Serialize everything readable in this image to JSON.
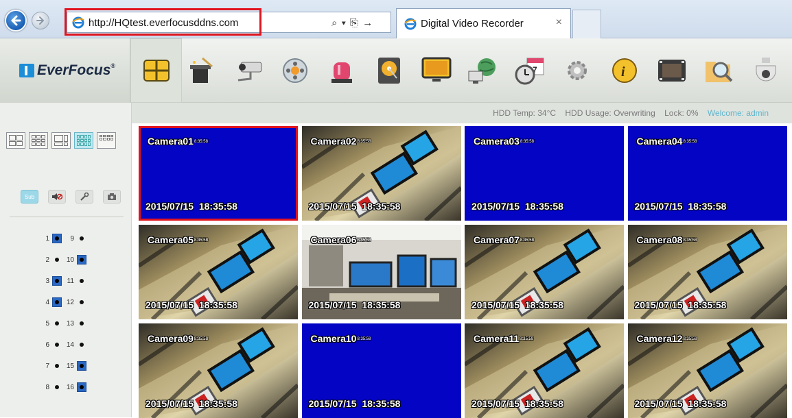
{
  "browser": {
    "url": "http://HQtest.everfocusddns.com",
    "address_tools": "⌕ ▾ ⎘ →",
    "tab_title": "Digital Video Recorder",
    "tab_close": "×"
  },
  "app": {
    "logo_text": "EverFocus",
    "logo_mark": "®"
  },
  "toolbar": {
    "items": [
      {
        "name": "live-view-icon",
        "active": true
      },
      {
        "name": "wizard-icon"
      },
      {
        "name": "camera-icon"
      },
      {
        "name": "record-icon"
      },
      {
        "name": "alarm-icon"
      },
      {
        "name": "hdd-icon"
      },
      {
        "name": "display-icon"
      },
      {
        "name": "network-icon"
      },
      {
        "name": "schedule-icon"
      },
      {
        "name": "settings-icon"
      },
      {
        "name": "info-icon"
      },
      {
        "name": "playback-icon"
      },
      {
        "name": "search-icon"
      },
      {
        "name": "ptz-icon"
      }
    ]
  },
  "status": {
    "hdd_temp_label": "HDD Temp:",
    "hdd_temp_value": "34°C",
    "hdd_usage_label": "HDD Usage:",
    "hdd_usage_value": "Overwriting",
    "lock_label": "Lock:",
    "lock_value": "0%",
    "welcome": "Welcome: admin"
  },
  "sidebar": {
    "sub_label": "Sub",
    "channels": [
      {
        "num": "1",
        "on": true
      },
      {
        "num": "9",
        "on": false
      },
      {
        "num": "2",
        "on": false
      },
      {
        "num": "10",
        "on": true
      },
      {
        "num": "3",
        "on": true
      },
      {
        "num": "11",
        "on": false
      },
      {
        "num": "4",
        "on": true
      },
      {
        "num": "12",
        "on": false
      },
      {
        "num": "5",
        "on": false
      },
      {
        "num": "13",
        "on": false
      },
      {
        "num": "6",
        "on": false
      },
      {
        "num": "14",
        "on": false
      },
      {
        "num": "7",
        "on": false
      },
      {
        "num": "15",
        "on": true
      },
      {
        "num": "8",
        "on": false
      },
      {
        "num": "16",
        "on": true
      }
    ]
  },
  "cameras": [
    {
      "name": "Camera01",
      "time": "2015/07/15  18:35:58",
      "clock": "8:35:58",
      "feed": false,
      "selected": true
    },
    {
      "name": "Camera02",
      "time": "2015/07/15  18:35:58",
      "clock": "8:35:58",
      "feed": true
    },
    {
      "name": "Camera03",
      "time": "2015/07/15  18:35:58",
      "clock": "8:35:58",
      "feed": false
    },
    {
      "name": "Camera04",
      "time": "2015/07/15  18:35:58",
      "clock": "8:35:58",
      "feed": false
    },
    {
      "name": "Camera05",
      "time": "2015/07/15  18:35:58",
      "clock": "8:35:58",
      "feed": true
    },
    {
      "name": "Camera06",
      "time": "2015/07/15  18:35:58",
      "clock": "8:35:58",
      "feed": true,
      "indoor": true
    },
    {
      "name": "Camera07",
      "time": "2015/07/15  18:35:58",
      "clock": "8:35:58",
      "feed": true
    },
    {
      "name": "Camera08",
      "time": "2015/07/15  18:35:58",
      "clock": "8:35:58",
      "feed": true
    },
    {
      "name": "Camera09",
      "time": "2015/07/15  18:35:58",
      "clock": "8:35:58",
      "feed": true
    },
    {
      "name": "Camera10",
      "time": "2015/07/15  18:35:58",
      "clock": "8:35:58",
      "feed": false
    },
    {
      "name": "Camera11",
      "time": "2015/07/15  18:35:58",
      "clock": "8:35:58",
      "feed": true
    },
    {
      "name": "Camera12",
      "time": "2015/07/15  18:35:58",
      "clock": "8:35:58",
      "feed": true
    }
  ]
}
